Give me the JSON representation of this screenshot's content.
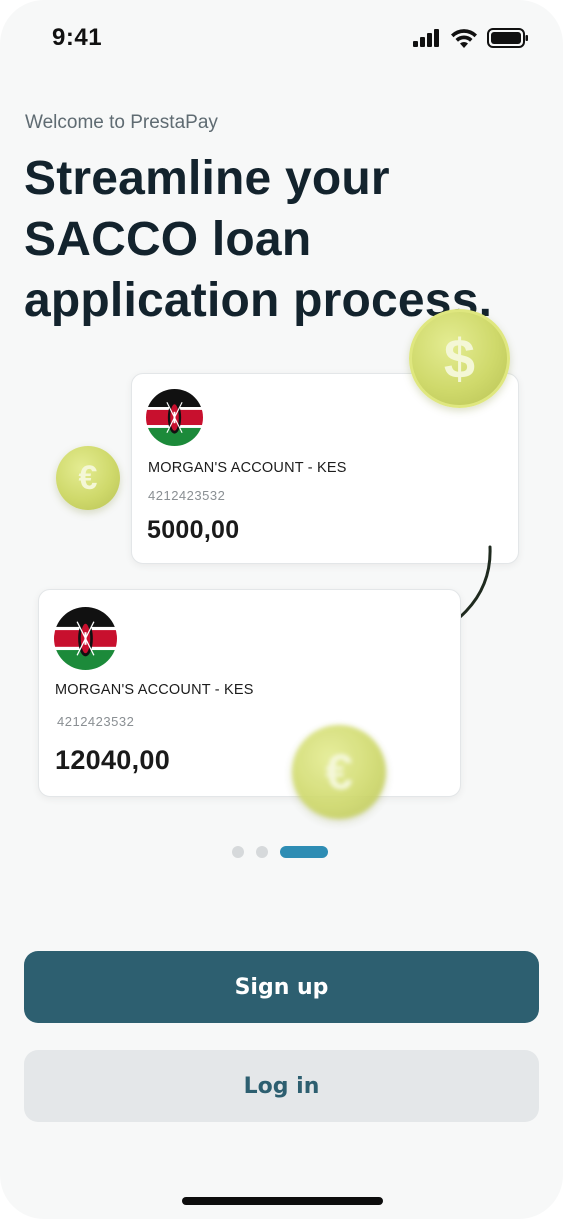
{
  "status_bar": {
    "time": "9:41",
    "icons": [
      "cellular-signal-icon",
      "wifi-icon",
      "battery-icon"
    ]
  },
  "onboarding": {
    "welcome": "Welcome to PrestaPay",
    "headline": "Streamline your SACCO loan application process."
  },
  "accounts": [
    {
      "flag": "kenya-flag-icon",
      "name": "MORGAN'S ACCOUNT - KES",
      "number": "4212423532",
      "balance": "5000,00"
    },
    {
      "flag": "kenya-flag-icon",
      "name": "MORGAN'S ACCOUNT - KES",
      "number": "4212423532",
      "balance": "12040,00"
    }
  ],
  "coins": {
    "dollar": "$",
    "euro": "€"
  },
  "pagination": {
    "total": 3,
    "active_index": 2
  },
  "actions": {
    "signup_label": "Sign up",
    "login_label": "Log in"
  },
  "colors": {
    "primary": "#2d5f70",
    "accent": "#2e8db4",
    "coin": "#cfd96b",
    "heading": "#13232d",
    "background": "#f7f8f8"
  }
}
